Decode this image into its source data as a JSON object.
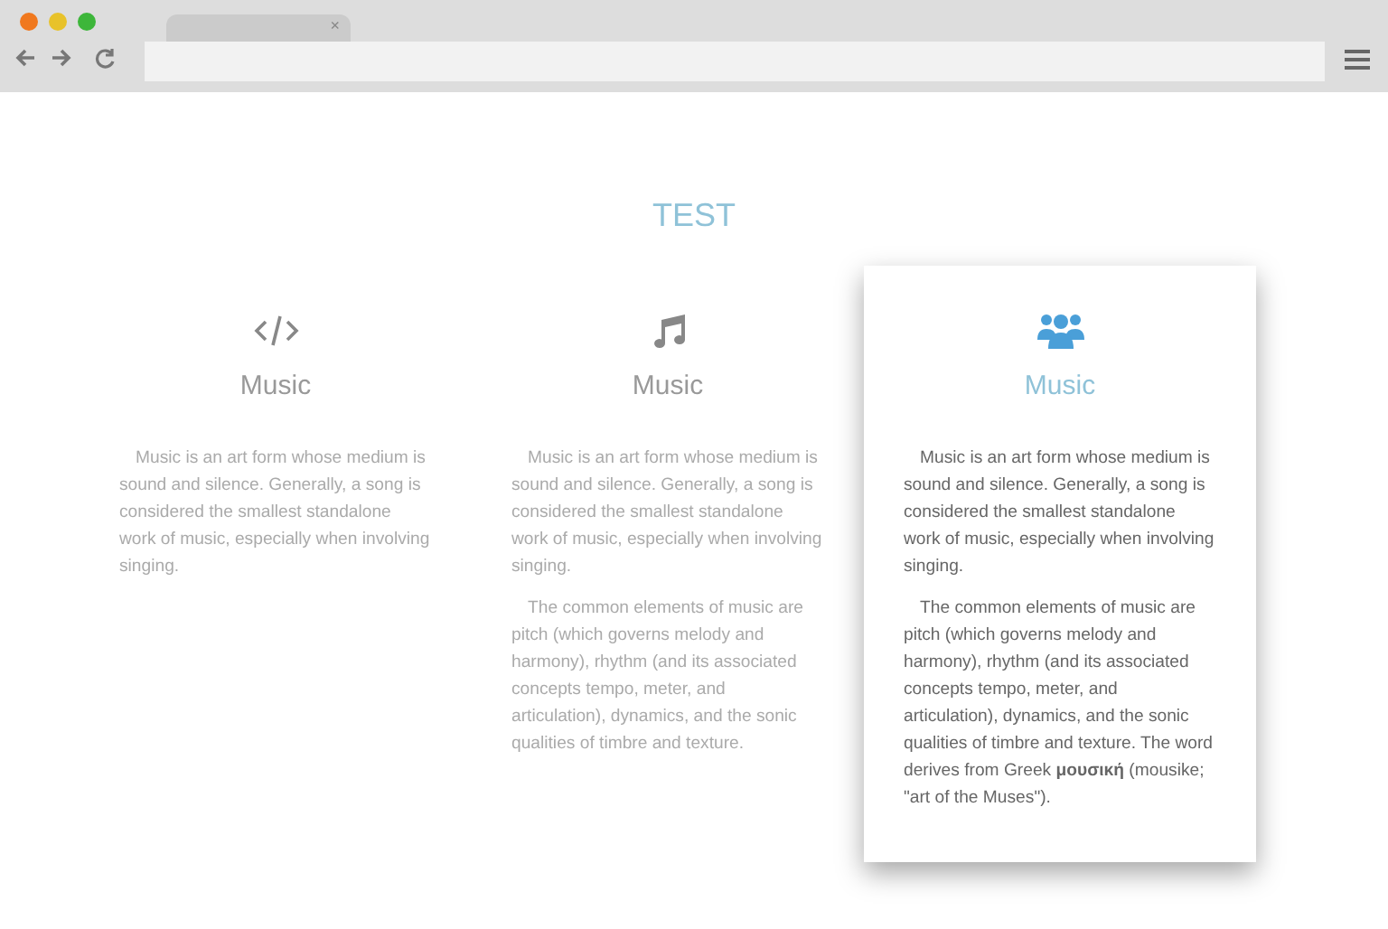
{
  "browser": {
    "tab_close": "×"
  },
  "heading": "TEST",
  "cards": [
    {
      "title": "Music",
      "selected": false,
      "paragraphs": [
        "Music is an art form whose medium is sound and silence. Generally, a song is considered the smallest standalone work of music, especially when involving singing."
      ]
    },
    {
      "title": "Music",
      "selected": false,
      "paragraphs": [
        "Music is an art form whose medium is sound and silence. Generally, a song is considered the smallest standalone work of music, especially when involving singing.",
        "The common elements of music are pitch (which governs melody and harmony), rhythm (and its associated concepts tempo, meter, and articulation), dynamics, and the sonic qualities of timbre and texture."
      ]
    },
    {
      "title": "Music",
      "selected": true,
      "paragraphs": [
        "Music is an art form whose medium is sound and silence. Generally, a song is considered the smallest standalone work of music, especially when involving singing.",
        "The common elements of music are pitch (which governs melody and harmony), rhythm (and its associated concepts tempo, meter, and articulation), dynamics, and the sonic qualities of timbre and texture. The word derives from Greek **μουσική** (mousike; \"art of the Muses\")."
      ]
    }
  ]
}
